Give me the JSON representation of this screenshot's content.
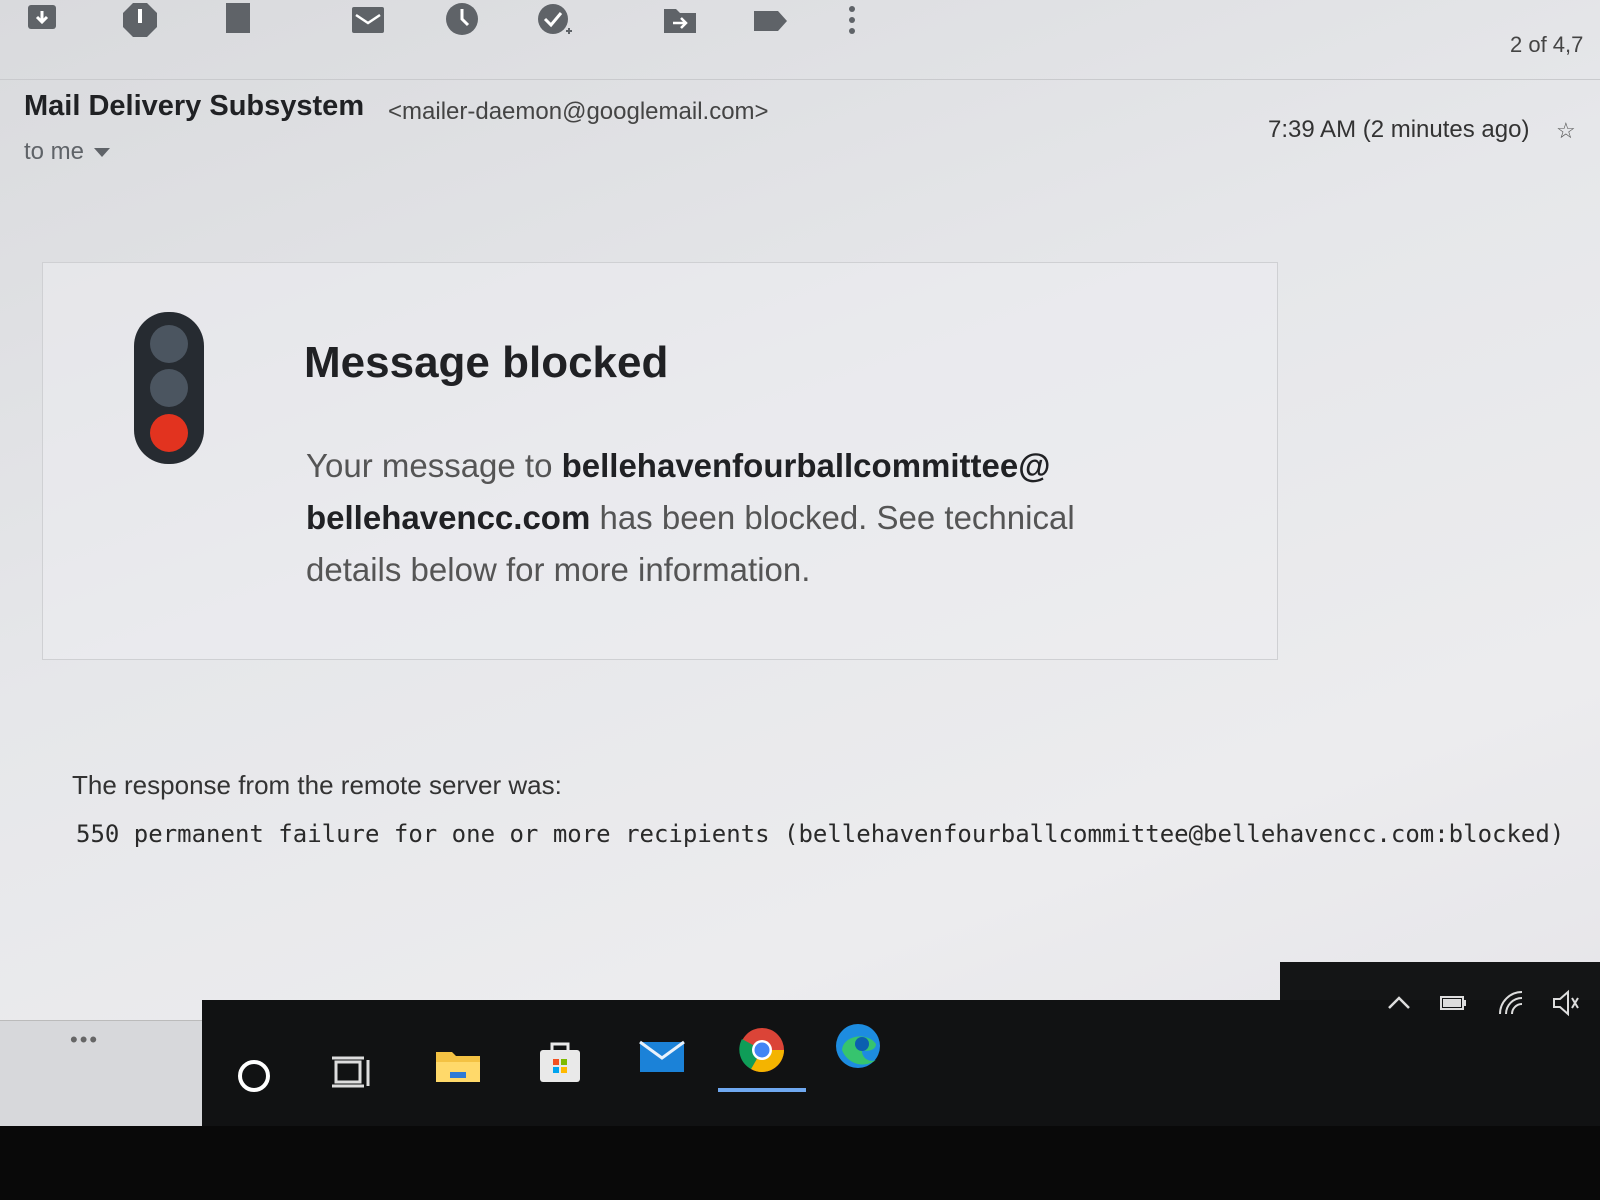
{
  "toolbar": {
    "actions": [
      {
        "name": "archive-icon"
      },
      {
        "name": "report-spam-icon"
      },
      {
        "name": "delete-icon"
      },
      {
        "name": "mark-unread-icon"
      },
      {
        "name": "snooze-icon"
      },
      {
        "name": "add-to-tasks-icon"
      },
      {
        "name": "move-to-icon"
      },
      {
        "name": "label-icon"
      },
      {
        "name": "more-options-icon"
      }
    ],
    "pager": "2 of 4,7"
  },
  "message": {
    "sender_name": "Mail Delivery Subsystem",
    "sender_email": "<mailer-daemon@googlemail.com>",
    "recipient": "to me",
    "timestamp": "7:39 AM (2 minutes ago)"
  },
  "card": {
    "icon": "traffic-light-red-icon",
    "title": "Message blocked",
    "body_prefix": "Your message to ",
    "blocked_address": "bellehavenfourballcommittee@ bellehavencc.com",
    "body_suffix": " has been blocked. See technical details below for more information."
  },
  "details": {
    "response_label": "The response from the remote server was:",
    "response_code": "550 permanent failure for one or more recipients (bellehavenfourballcommittee@bellehavencc.com:blocked)"
  },
  "taskbar": {
    "more_label": "•••",
    "apps": [
      {
        "name": "cortana-icon"
      },
      {
        "name": "task-view-icon"
      },
      {
        "name": "file-explorer-icon"
      },
      {
        "name": "microsoft-store-icon"
      },
      {
        "name": "mail-app-icon"
      },
      {
        "name": "chrome-icon",
        "active": true
      },
      {
        "name": "edge-icon"
      }
    ],
    "tray": [
      {
        "name": "show-hidden-icons-icon"
      },
      {
        "name": "battery-icon"
      },
      {
        "name": "wifi-icon"
      },
      {
        "name": "volume-icon"
      }
    ]
  },
  "colors": {
    "red_light": "#e2331f",
    "taskbar": "#111213",
    "active_indicator": "#6fa8f0"
  }
}
